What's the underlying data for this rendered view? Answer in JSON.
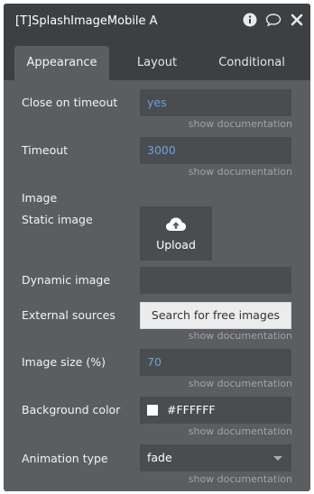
{
  "window": {
    "title": "[T]SplashImageMobile A"
  },
  "title_icons": [
    "info-icon",
    "comment-icon",
    "close-icon"
  ],
  "tabs": [
    {
      "label": "Appearance",
      "active": true
    },
    {
      "label": "Layout",
      "active": false
    },
    {
      "label": "Conditional",
      "active": false
    }
  ],
  "doc_link": "show documentation",
  "fields": {
    "close_on_timeout": {
      "label": "Close on timeout",
      "value": "yes"
    },
    "timeout": {
      "label": "Timeout",
      "value": "3000"
    },
    "image_section": {
      "label": "Image"
    },
    "static_image": {
      "label": "Static image",
      "button": "Upload"
    },
    "dynamic_image": {
      "label": "Dynamic image",
      "value": ""
    },
    "external_sources": {
      "label": "External sources",
      "button": "Search for free images"
    },
    "image_size": {
      "label": "Image size (%)",
      "value": "70"
    },
    "background_color": {
      "label": "Background color",
      "value": "#FFFFFF"
    },
    "animation_type": {
      "label": "Animation type",
      "value": "fade"
    }
  },
  "colors": {
    "panel_bg": "#5b5e61",
    "header_bg": "#3d4043",
    "field_bg": "#4a4d50",
    "value_blue": "#6f9fd8",
    "doc_text": "#9fa3a7",
    "swatch": "#FFFFFF"
  }
}
